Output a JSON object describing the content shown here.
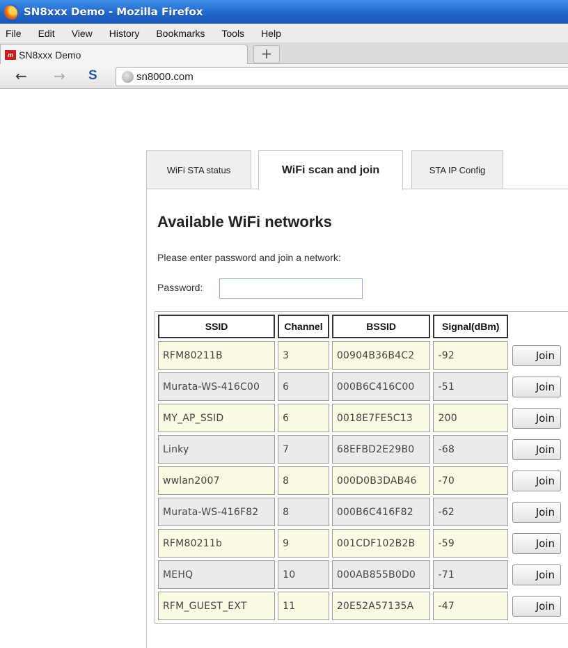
{
  "window": {
    "title": "SN8xxx Demo - Mozilla Firefox"
  },
  "menubar": {
    "items": [
      "File",
      "Edit",
      "View",
      "History",
      "Bookmarks",
      "Tools",
      "Help"
    ]
  },
  "browser_tab": {
    "label": "SN8xxx Demo",
    "favicon_text": "ꭆ",
    "new_tab": "+"
  },
  "navbar": {
    "url": "sn8000.com",
    "back": "🡐",
    "forward": "🡒",
    "sync": "S"
  },
  "page_tabs": [
    {
      "label": "WiFi STA status"
    },
    {
      "label": "WiFi scan and join"
    },
    {
      "label": "STA IP Config"
    }
  ],
  "content": {
    "heading": "Available WiFi networks",
    "instruction": "Please enter password and join a network:",
    "password_label": "Password:",
    "password_value": ""
  },
  "table": {
    "headers": [
      "SSID",
      "Channel",
      "BSSID",
      "Signal(dBm)",
      ""
    ],
    "join_label": "Join",
    "rows": [
      [
        "RFM80211B",
        "3",
        "00904B36B4C2",
        "-92"
      ],
      [
        "Murata-WS-416C00",
        "6",
        "000B6C416C00",
        "-51"
      ],
      [
        "MY_AP_SSID",
        "6",
        "0018E7FE5C13",
        "200"
      ],
      [
        "Linky",
        "7",
        "68EFBD2E29B0",
        "-68"
      ],
      [
        "wwlan2007",
        "8",
        "000D0B3DAB46",
        "-70"
      ],
      [
        "Murata-WS-416F82",
        "8",
        "000B6C416F82",
        "-62"
      ],
      [
        "RFM80211b",
        "9",
        "001CDF102B2B",
        "-59"
      ],
      [
        "MEHQ",
        "10",
        "000AB855B0D0",
        "-71"
      ],
      [
        "RFM_GUEST_EXT",
        "11",
        "20E52A57135A",
        "-47"
      ]
    ]
  }
}
